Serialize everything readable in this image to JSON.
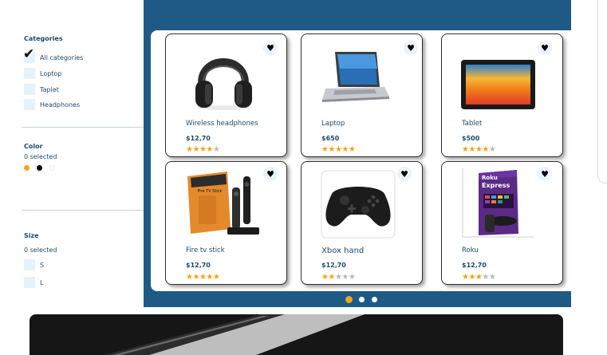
{
  "filters": {
    "categories": {
      "title": "Categories",
      "options": [
        {
          "label": "All categories",
          "checked": true
        },
        {
          "label": "Loptop",
          "checked": false
        },
        {
          "label": "Tapiet",
          "checked": false
        },
        {
          "label": "Headphones",
          "checked": false
        }
      ]
    },
    "color": {
      "title": "Color",
      "selected_text": "0 selected",
      "swatches": [
        "#f2a516",
        "#000000",
        "#ffffff"
      ]
    },
    "size": {
      "title": "Size",
      "selected_text": "0 selected",
      "options": [
        {
          "label": "S",
          "checked": false
        },
        {
          "label": "L",
          "checked": false
        }
      ]
    }
  },
  "products": [
    {
      "name": "Wireless headphones",
      "price": "$12,70",
      "rating": 4,
      "icon": "headphones-image"
    },
    {
      "name": "Laptop",
      "price": "$650",
      "rating": 5,
      "icon": "laptop-image"
    },
    {
      "name": "Tablet",
      "price": "$500",
      "rating": 4,
      "icon": "tablet-image"
    },
    {
      "name": "Fire tv stick",
      "price": "$12,70",
      "rating": 5,
      "icon": "fire-tv-stick-image"
    },
    {
      "name": "Xbox hand",
      "price": "$12,70",
      "rating": 2,
      "icon": "xbox-controller-image"
    },
    {
      "name": "Roku",
      "price": "$12,70",
      "rating": 3,
      "icon": "roku-express-image"
    }
  ],
  "product_images": {
    "firetv_box_text": "Fire TV Stick",
    "roku_brand": "Roku",
    "roku_model": "Express"
  },
  "carousel": {
    "pages": 3,
    "active": 0
  },
  "colors": {
    "panel": "#1f5a85",
    "accent": "#f2a516",
    "text": "#1d4a6e"
  }
}
